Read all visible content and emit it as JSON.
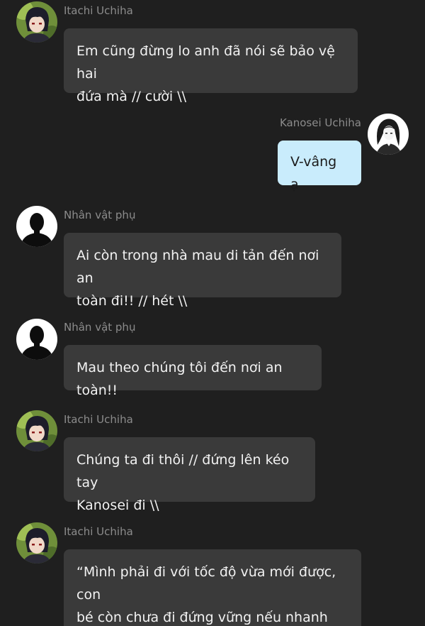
{
  "messages": [
    {
      "sender": "Itachi Uchiha",
      "avatar": "itachi-avatar-icon",
      "text": "Em cũng đừng lo anh đã nói sẽ bảo vệ hai\nđứa mà // cười \\\\"
    },
    {
      "sender": "Kanosei Uchiha",
      "avatar": "kanosei-avatar-icon",
      "text": "V-vâng ạ"
    },
    {
      "sender": "Nhân vật phụ",
      "avatar": "silhouette-avatar-icon",
      "text": "Ai còn trong nhà mau di tản đến nơi an\ntoàn đi!! // hét \\\\"
    },
    {
      "sender": "Nhân vật phụ",
      "avatar": "silhouette-avatar-icon",
      "text": "Mau theo chúng tôi đến nơi an toàn!!"
    },
    {
      "sender": "Itachi Uchiha",
      "avatar": "itachi-avatar-icon",
      "text": "Chúng ta đi thôi // đứng lên kéo tay\nKanosei đi \\\\"
    },
    {
      "sender": "Itachi Uchiha",
      "avatar": "itachi-avatar-icon",
      "text": "“Mình phải đi với tốc độ vừa mới được, con\nbé còn chưa đi đứng vững nếu nhanh quá\ncon bé sẽ bị ngã mất”"
    }
  ],
  "colors": {
    "background": "#1f1f1f",
    "bubble_other": "#3a3a3a",
    "bubble_self": "#c9ecfc",
    "name_text": "#8c8c8c"
  }
}
